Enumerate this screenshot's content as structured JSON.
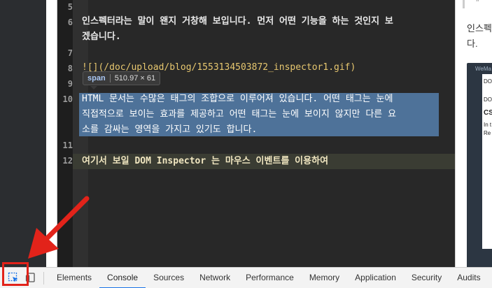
{
  "editor": {
    "lines": [
      {
        "num": "5",
        "text": ""
      },
      {
        "num": "6",
        "text": "인스펙터라는 말이 왠지 거창해 보입니다. 먼저 어떤 기능을 하는 것인지 보"
      },
      {
        "num": "",
        "text": "겠습니다."
      },
      {
        "num": "7",
        "text": ""
      },
      {
        "num": "8",
        "text": "![](/doc/upload/blog/1553134503872_inspector1.gif)"
      },
      {
        "num": "9",
        "text": ""
      },
      {
        "num": "10",
        "text": "HTML 문서는 수많은 태그의 조합으로 이루어져 있습니다. 어떤 태그는 눈에"
      },
      {
        "num": "",
        "text": "직접적으로 보이는 효과를 제공하고 어떤 태그는 눈에 보이지 않지만 다른 요"
      },
      {
        "num": "",
        "text": "소를 감싸는 영역을 가지고 있기도 합니다."
      },
      {
        "num": "11",
        "text": ""
      },
      {
        "num": "12",
        "text": "여기서 보일 DOM Inspector 는 마우스 이벤트를 이용하여"
      }
    ],
    "tooltip": {
      "tag": "span",
      "size": "510.97 × 61"
    }
  },
  "preview": {
    "quote": "”",
    "line1": "인스펙",
    "line2": "다.",
    "thumb_header": "WeMa",
    "thumb_lines": [
      "DOM",
      "DO",
      "CS",
      "In t",
      "Re"
    ]
  },
  "devtools": {
    "tabs": [
      "Elements",
      "Console",
      "Sources",
      "Network",
      "Performance",
      "Memory",
      "Application",
      "Security",
      "Audits"
    ],
    "active_tab": "Console",
    "accent_color": "#1a73e8",
    "highlight_color": "#e2231a"
  }
}
